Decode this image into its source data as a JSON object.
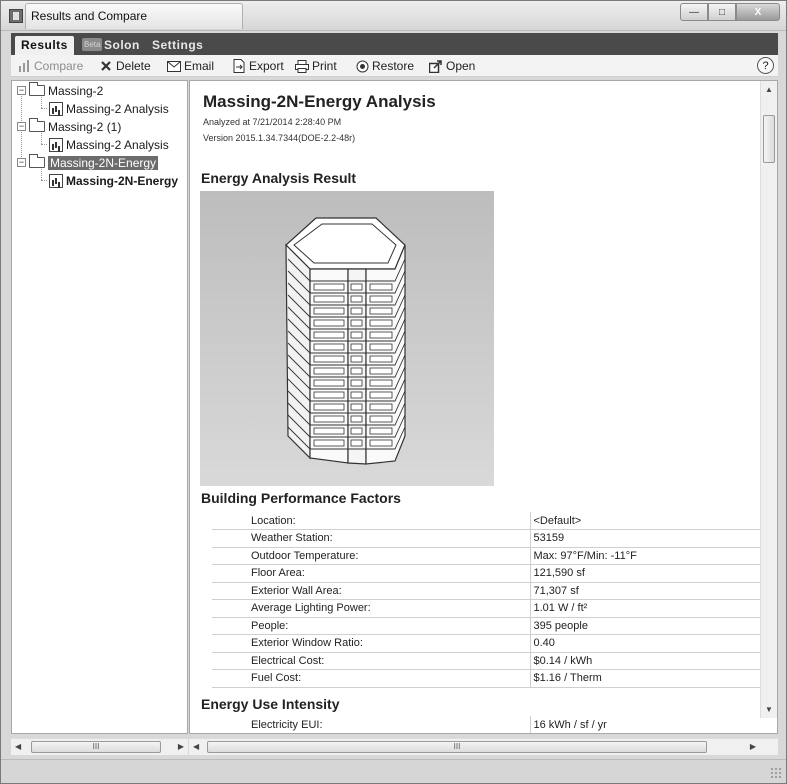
{
  "window": {
    "title": "Results and Compare",
    "buttons": {
      "minimize": "—",
      "maximize": "□",
      "close": "X"
    }
  },
  "tabs": [
    {
      "label": "Results",
      "active": true
    },
    {
      "label": "Beta",
      "badge": true
    },
    {
      "label": "Solon",
      "active": false
    },
    {
      "label": "Settings",
      "active": false
    }
  ],
  "toolbar": {
    "compare": "Compare",
    "delete": "Delete",
    "email": "Email",
    "export": "Export",
    "print": "Print",
    "restore": "Restore",
    "open": "Open",
    "help": "?"
  },
  "tree": [
    {
      "label": "Massing-2",
      "type": "folder"
    },
    {
      "label": "Massing-2 Analysis",
      "type": "analysis"
    },
    {
      "label": "Massing-2 (1)",
      "type": "folder"
    },
    {
      "label": "Massing-2 Analysis",
      "type": "analysis"
    },
    {
      "label": "Massing-2N-Energy",
      "type": "folder",
      "selected": true
    },
    {
      "label": "Massing-2N-Energy",
      "type": "analysis",
      "bold": true
    }
  ],
  "report": {
    "title": "Massing-2N-Energy Analysis",
    "analyzed_at": "Analyzed at 7/21/2014 2:28:40 PM",
    "version": "Version 2015.1.34.7344(DOE-2.2-48r)",
    "section_result": "Energy Analysis Result",
    "section_factors": "Building Performance Factors",
    "factors": [
      {
        "label": "Location:",
        "value": "<Default>"
      },
      {
        "label": "Weather Station:",
        "value": "53159"
      },
      {
        "label": "Outdoor Temperature:",
        "value": "Max: 97°F/Min: -11°F"
      },
      {
        "label": "Floor Area:",
        "value": "121,590 sf"
      },
      {
        "label": "Exterior Wall Area:",
        "value": "71,307 sf"
      },
      {
        "label": "Average Lighting Power:",
        "value": "1.01 W / ft²"
      },
      {
        "label": "People:",
        "value": "395 people"
      },
      {
        "label": "Exterior Window Ratio:",
        "value": "0.40"
      },
      {
        "label": "Electrical Cost:",
        "value": "$0.14 / kWh"
      },
      {
        "label": "Fuel Cost:",
        "value": "$1.16 / Therm"
      }
    ],
    "section_eui": "Energy Use Intensity",
    "eui": [
      {
        "label": "Electricity EUI:",
        "value": "16 kWh / sf / yr"
      }
    ]
  },
  "scrollbars": {
    "tree_h_thumb": "III",
    "main_h_thumb": "III"
  }
}
